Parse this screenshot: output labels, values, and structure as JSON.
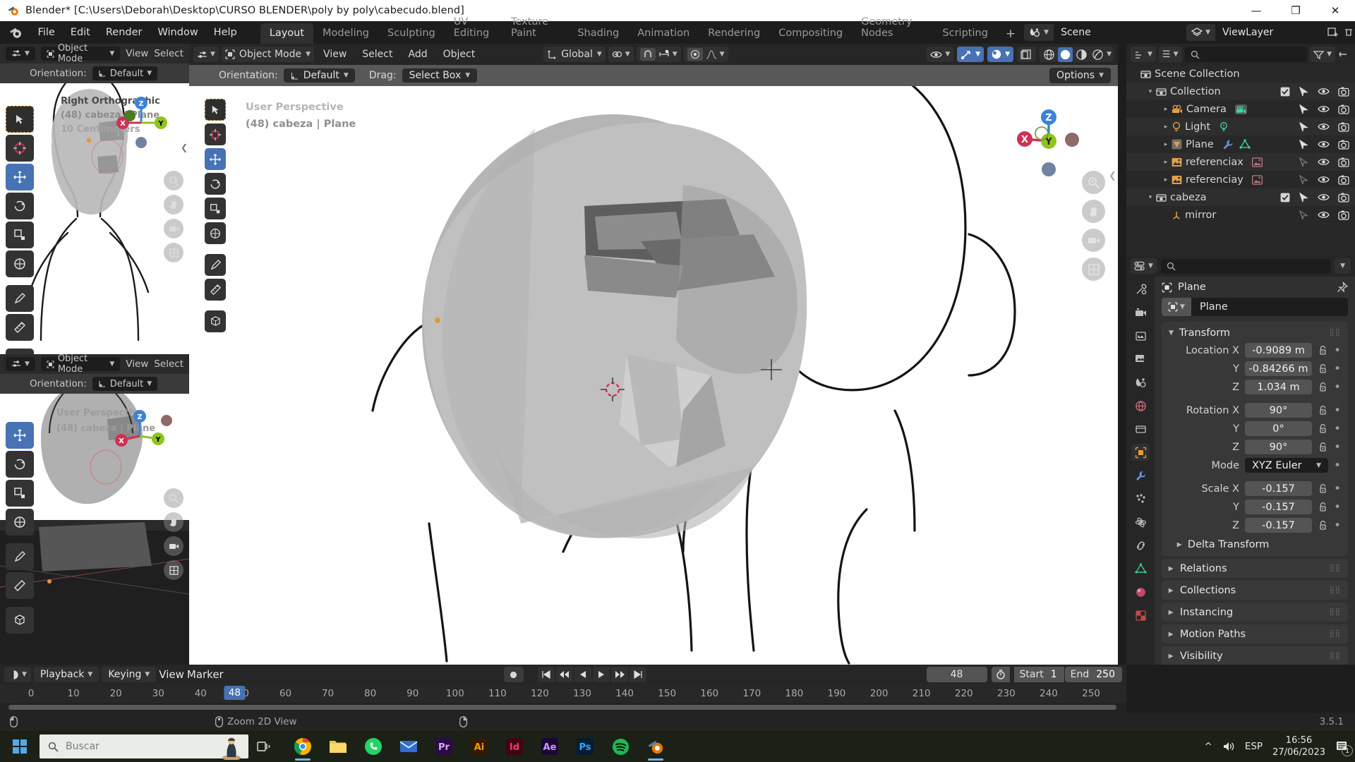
{
  "window": {
    "title": "Blender* [C:\\Users\\Deborah\\Desktop\\CURSO BLENDER\\poly by poly\\cabecudo.blend]",
    "minimize": "—",
    "maximize": "❐",
    "close": "✕"
  },
  "topbar": {
    "menus": [
      "File",
      "Edit",
      "Render",
      "Window",
      "Help"
    ],
    "tabs": [
      "Layout",
      "Modeling",
      "Sculpting",
      "UV Editing",
      "Texture Paint",
      "Shading",
      "Animation",
      "Rendering",
      "Compositing",
      "Geometry Nodes",
      "Scripting"
    ],
    "active_tab": "Layout",
    "add_tab": "+",
    "scene_name": "Scene",
    "view_layer_name": "ViewLayer"
  },
  "viewport_left_top": {
    "mode": "Object Mode",
    "menus": [
      "View",
      "Select"
    ],
    "orientation_label": "Orientation:",
    "orientation_value": "Default",
    "overlay_line1": "Right Orthographic",
    "overlay_line2": "(48) cabeza | Plane",
    "overlay_line3": "10 Centimeters"
  },
  "viewport_left_bottom": {
    "mode": "Object Mode",
    "menus": [
      "View",
      "Select"
    ],
    "orientation_label": "Orientation:",
    "orientation_value": "Default",
    "overlay_line1": "User Perspective",
    "overlay_line2": "(48) cabeza | Plane"
  },
  "viewport_main": {
    "mode": "Object Mode",
    "menus": [
      "View",
      "Select",
      "Add",
      "Object"
    ],
    "transform_orientation": "Global",
    "orientation_label": "Orientation:",
    "orientation_value": "Default",
    "drag_label": "Drag:",
    "drag_value": "Select Box",
    "options_label": "Options",
    "overlay_line1": "User Perspective",
    "overlay_line2": "(48) cabeza | Plane",
    "gizmo_axes": [
      "Z",
      "X",
      "Y"
    ]
  },
  "outliner": {
    "search_placeholder": "",
    "rows": [
      {
        "label": "Scene Collection",
        "icon": "collection-icon",
        "depth": 0,
        "tri": "",
        "checkbox": false,
        "extras": []
      },
      {
        "label": "Collection",
        "icon": "collection-icon",
        "depth": 1,
        "tri": "▾",
        "checkbox": true,
        "extras": []
      },
      {
        "label": "Camera",
        "icon": "camera-icon",
        "depth": 2,
        "tri": "▸",
        "checkbox": false,
        "extras": [
          "camera-data-icon"
        ]
      },
      {
        "label": "Light",
        "icon": "light-icon",
        "depth": 2,
        "tri": "▸",
        "checkbox": false,
        "extras": [
          "light-data-icon"
        ]
      },
      {
        "label": "Plane",
        "icon": "mesh-icon",
        "depth": 2,
        "tri": "▸",
        "checkbox": false,
        "extras": [
          "modifier-icon",
          "mesh-data-icon"
        ]
      },
      {
        "label": "referenciax",
        "icon": "image-icon",
        "depth": 2,
        "tri": "▸",
        "checkbox": false,
        "extras": [
          "image-data-icon"
        ]
      },
      {
        "label": "referenciay",
        "icon": "image-icon",
        "depth": 2,
        "tri": "▸",
        "checkbox": false,
        "extras": [
          "image-data-icon"
        ]
      },
      {
        "label": "cabeza",
        "icon": "collection-icon",
        "depth": 1,
        "tri": "▾",
        "checkbox": true,
        "extras": []
      },
      {
        "label": "mirror",
        "icon": "empty-icon",
        "depth": 2,
        "tri": "",
        "checkbox": false,
        "extras": []
      }
    ]
  },
  "properties": {
    "breadcrumb_object": "Plane",
    "id_name": "Plane",
    "panel_title": "Transform",
    "fields": [
      {
        "label": "Location X",
        "value": "-0.9089 m"
      },
      {
        "label": "Y",
        "value": "-0.84266 m"
      },
      {
        "label": "Z",
        "value": "1.034 m"
      },
      {
        "label": "Rotation X",
        "value": "90°"
      },
      {
        "label": "Y",
        "value": "0°"
      },
      {
        "label": "Z",
        "value": "90°"
      }
    ],
    "mode_label": "Mode",
    "mode_value": "XYZ Euler",
    "scale_fields": [
      {
        "label": "Scale X",
        "value": "-0.157"
      },
      {
        "label": "Y",
        "value": "-0.157"
      },
      {
        "label": "Z",
        "value": "-0.157"
      }
    ],
    "subpanel": "Delta Transform",
    "closed_panels": [
      "Relations",
      "Collections",
      "Instancing",
      "Motion Paths",
      "Visibility"
    ]
  },
  "timeline": {
    "menus": [
      "Playback",
      "Keying",
      "View",
      "Marker"
    ],
    "current_frame": "48",
    "start_label": "Start",
    "start_value": "1",
    "end_label": "End",
    "end_value": "250",
    "ticks": [
      "0",
      "10",
      "20",
      "30",
      "40",
      "50",
      "60",
      "70",
      "80",
      "90",
      "100",
      "110",
      "120",
      "130",
      "140",
      "150",
      "160",
      "170",
      "180",
      "190",
      "200",
      "210",
      "220",
      "230",
      "240",
      "250"
    ],
    "playhead_label": "48"
  },
  "statusbar": {
    "hint": "Zoom 2D View",
    "version": "3.5.1"
  },
  "taskbar": {
    "search_placeholder": "Buscar",
    "apps": [
      "chrome-icon",
      "file-explorer-icon",
      "whatsapp-icon",
      "mail-icon",
      "premiere-icon",
      "illustrator-icon",
      "indesign-icon",
      "aftereffects-icon",
      "photoshop-icon",
      "spotify-icon",
      "blender-icon"
    ],
    "language": "ESP",
    "time": "16:56",
    "date": "27/06/2023",
    "notification_count": "1"
  },
  "colors": {
    "accent_blue": "#4772b3",
    "axis_x": "#cc3355",
    "axis_y": "#8fc31f",
    "axis_z": "#3b82d6",
    "orange": "#e0963c",
    "panel_bg": "#303030",
    "header_bg": "#262626"
  }
}
